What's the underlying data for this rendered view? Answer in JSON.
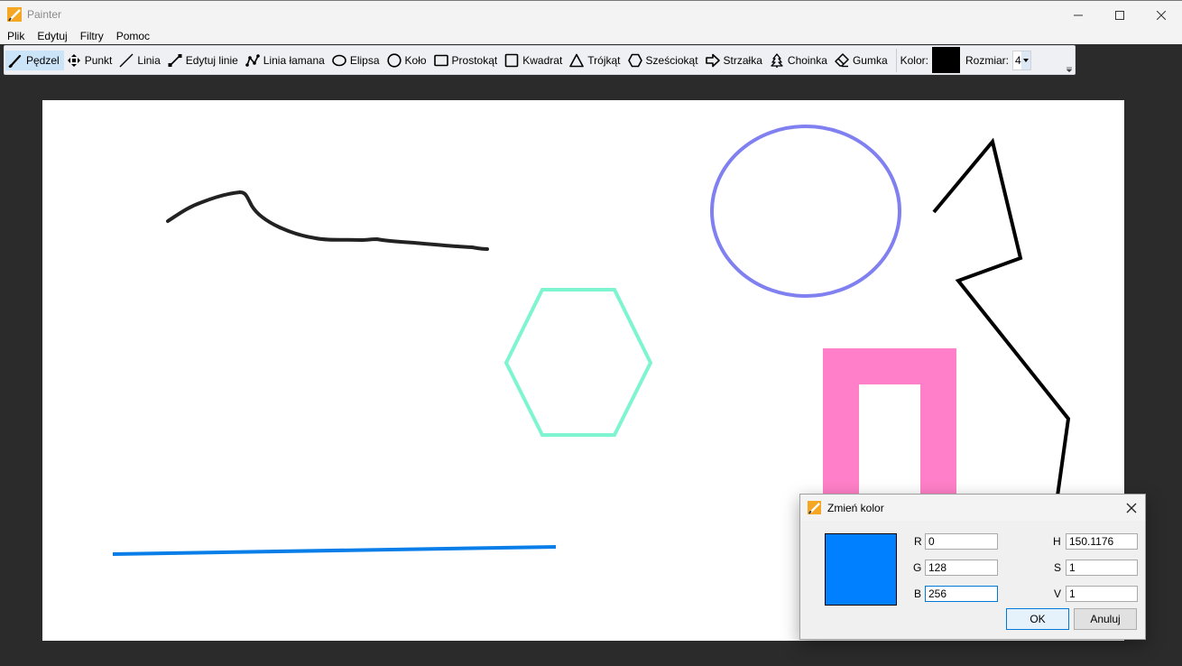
{
  "window": {
    "title": "Painter"
  },
  "menu": [
    "Plik",
    "Edytuj",
    "Filtry",
    "Pomoc"
  ],
  "toolbar": {
    "tools": [
      {
        "id": "brush",
        "label": "Pędzel",
        "icon": "brush-icon",
        "active": true
      },
      {
        "id": "point",
        "label": "Punkt",
        "icon": "move-arrows-icon",
        "active": false
      },
      {
        "id": "line",
        "label": "Linia",
        "icon": "line-icon",
        "active": false
      },
      {
        "id": "edit-lines",
        "label": "Edytuj linie",
        "icon": "edit-line-icon",
        "active": false
      },
      {
        "id": "polyline",
        "label": "Linia łamana",
        "icon": "polyline-icon",
        "active": false
      },
      {
        "id": "ellipse",
        "label": "Elipsa",
        "icon": "ellipse-icon",
        "active": false
      },
      {
        "id": "circle",
        "label": "Koło",
        "icon": "circle-icon",
        "active": false
      },
      {
        "id": "rectangle",
        "label": "Prostokąt",
        "icon": "rectangle-icon",
        "active": false
      },
      {
        "id": "square",
        "label": "Kwadrat",
        "icon": "square-icon",
        "active": false
      },
      {
        "id": "triangle",
        "label": "Trójkąt",
        "icon": "triangle-icon",
        "active": false
      },
      {
        "id": "hexagon",
        "label": "Sześciokąt",
        "icon": "hexagon-icon",
        "active": false
      },
      {
        "id": "arrow",
        "label": "Strzałka",
        "icon": "arrow-icon",
        "active": false
      },
      {
        "id": "tree",
        "label": "Choinka",
        "icon": "tree-icon",
        "active": false
      },
      {
        "id": "eraser",
        "label": "Gumka",
        "icon": "eraser-icon",
        "active": false
      }
    ],
    "color_label": "Kolor:",
    "color_value": "#000000",
    "size_label": "Rozmiar:",
    "size_value": "4"
  },
  "canvas": {
    "colors": {
      "brush_stroke": "#222222",
      "hexagon": "#7ef5d0",
      "ellipse": "#8080f0",
      "polyline": "#000000",
      "rectangle": "#ff80c8",
      "line": "#0a7ee8"
    }
  },
  "dialog": {
    "title": "Zmień kolor",
    "preview_color": "#0080ff",
    "fields": {
      "r": {
        "label": "R",
        "value": "0"
      },
      "g": {
        "label": "G",
        "value": "128"
      },
      "b": {
        "label": "B",
        "value": "256"
      },
      "h": {
        "label": "H",
        "value": "150.1176"
      },
      "s": {
        "label": "S",
        "value": "1"
      },
      "v": {
        "label": "V",
        "value": "1"
      }
    },
    "ok_label": "OK",
    "cancel_label": "Anuluj"
  }
}
